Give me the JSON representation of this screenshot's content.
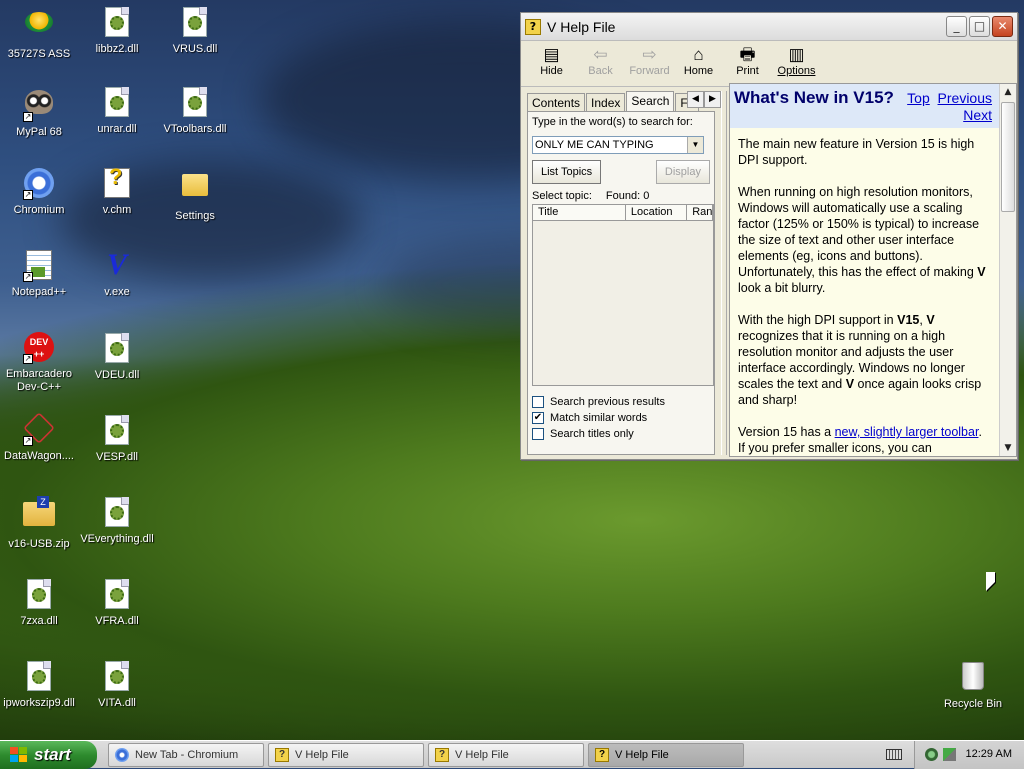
{
  "desktop": {
    "icons": [
      {
        "label": "35727S ASS",
        "icon": "noodle-bowl-icon"
      },
      {
        "label": "libbz2.dll",
        "icon": "dll-file-icon"
      },
      {
        "label": "VRUS.dll",
        "icon": "dll-file-icon"
      },
      {
        "label": "MyPal 68",
        "icon": "raccoon-browser-icon"
      },
      {
        "label": "unrar.dll",
        "icon": "dll-file-icon"
      },
      {
        "label": "VToolbars.dll",
        "icon": "dll-file-icon"
      },
      {
        "label": "Chromium",
        "icon": "chromium-icon"
      },
      {
        "label": "v.chm",
        "icon": "help-file-icon"
      },
      {
        "label": "Settings",
        "icon": "folder-icon"
      },
      {
        "label": "Notepad++",
        "icon": "notepadpp-icon"
      },
      {
        "label": "v.exe",
        "icon": "v-exe-icon"
      },
      {
        "label": "Embarcadero Dev-C++",
        "icon": "devcpp-icon"
      },
      {
        "label": "VDEU.dll",
        "icon": "dll-file-icon"
      },
      {
        "label": "DataWagon....",
        "icon": "datawagon-icon"
      },
      {
        "label": "VESP.dll",
        "icon": "dll-file-icon"
      },
      {
        "label": "v16-USB.zip",
        "icon": "zip-folder-icon"
      },
      {
        "label": "VEverything.dll",
        "icon": "dll-file-icon"
      },
      {
        "label": "7zxa.dll",
        "icon": "dll-file-icon"
      },
      {
        "label": "VFRA.dll",
        "icon": "dll-file-icon"
      },
      {
        "label": "ipworkszip9.dll",
        "icon": "dll-file-icon"
      },
      {
        "label": "VITA.dll",
        "icon": "dll-file-icon"
      },
      {
        "label": "Recycle Bin",
        "icon": "recycle-bin-icon"
      }
    ]
  },
  "help_window": {
    "title": "V Help File",
    "controls": {
      "minimize": "_",
      "maximize": "□",
      "close": "✕"
    },
    "toolbar": [
      {
        "label": "Hide",
        "enabled": true,
        "glyph": "▤"
      },
      {
        "label": "Back",
        "enabled": false,
        "glyph": "⇦"
      },
      {
        "label": "Forward",
        "enabled": false,
        "glyph": "⇨"
      },
      {
        "label": "Home",
        "enabled": true,
        "glyph": "⌂"
      },
      {
        "label": "Print",
        "enabled": true,
        "glyph": "🖶"
      },
      {
        "label": "Options",
        "enabled": true,
        "glyph": "▥"
      }
    ],
    "nav": {
      "tabs": [
        "Contents",
        "Index",
        "Search",
        "Fa"
      ],
      "active_tab": "Search",
      "search_prompt": "Type in the word(s) to search for:",
      "search_value": "ONLY ME CAN TYPING",
      "list_topics": "List Topics",
      "display": "Display",
      "select_topic": "Select topic:",
      "found": "Found: 0",
      "columns": [
        "Title",
        "Location",
        "Rank"
      ],
      "options": [
        {
          "label": "Search previous results",
          "checked": false
        },
        {
          "label": "Match similar words",
          "checked": true
        },
        {
          "label": "Search titles only",
          "checked": false
        }
      ]
    },
    "content": {
      "heading": "What's New in V15?",
      "links": {
        "top": "Top",
        "previous": "Previous",
        "next": "Next"
      },
      "p1": "The main new feature in Version 15 is high DPI support.",
      "p2a": "When running on high resolution monitors, Windows will automatically use a scaling factor (125% or 150% is typical) to increase the size of text and other user interface elements (eg, icons and buttons). Unfortunately, this has the effect of making ",
      "p2b": "V",
      "p2c": " look a bit blurry.",
      "p3a": "With the high DPI support in ",
      "p3b": "V15",
      "p3c": ", ",
      "p3d": "V",
      "p3e": " recognizes that it is running on a high resolution monitor and adjusts the user interface accordingly. Windows no longer scales the text and ",
      "p3f": "V",
      "p3g": " once again looks crisp and sharp!",
      "p4a": "Version 15 has a ",
      "p4link": "new, slightly larger toolbar",
      "p4b": ". If you prefer smaller icons, you can"
    }
  },
  "taskbar": {
    "start": "start",
    "tasks": [
      {
        "label": "New Tab - Chromium",
        "icon": "chromium-icon",
        "active": false
      },
      {
        "label": "V Help File",
        "icon": "help-file-icon",
        "active": false
      },
      {
        "label": "V Help File",
        "icon": "help-file-icon",
        "active": false
      },
      {
        "label": "V Help File",
        "icon": "help-file-icon",
        "active": true
      }
    ],
    "clock": "12:29 AM"
  }
}
